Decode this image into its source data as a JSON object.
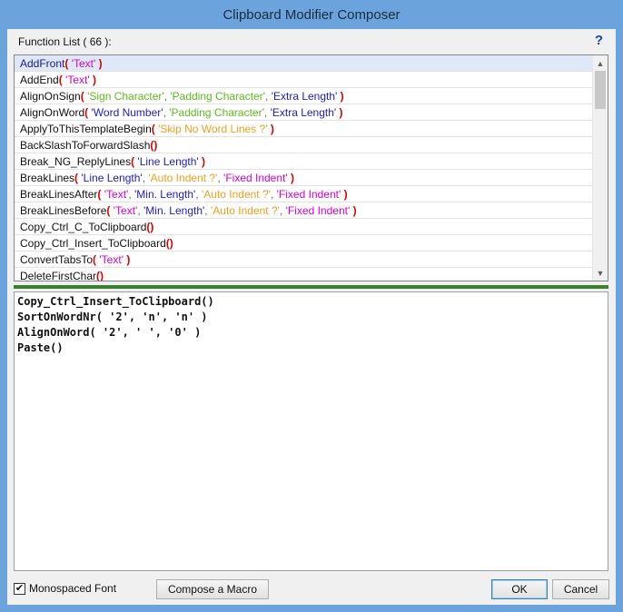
{
  "window": {
    "title": "Clipboard Modifier Composer"
  },
  "function_list": {
    "label": "Function List ( 66 ):",
    "help": "?",
    "selected_index": 0,
    "items": [
      {
        "name": "AddFront",
        "args": [
          {
            "text": "'Text'",
            "color": "#d400d4"
          }
        ]
      },
      {
        "name": "AddEnd",
        "args": [
          {
            "text": "'Text'",
            "color": "#d400d4"
          }
        ]
      },
      {
        "name": "AlignOnSign",
        "args": [
          {
            "text": "'Sign Character'",
            "color": "#5fba1f"
          },
          {
            "text": "'Padding Character'",
            "color": "#5fba1f"
          },
          {
            "text": "'Extra Length'",
            "color": "#1c1cc8"
          }
        ]
      },
      {
        "name": "AlignOnWord",
        "args": [
          {
            "text": "'Word Number'",
            "color": "#1c1cc8"
          },
          {
            "text": "'Padding Character'",
            "color": "#5fba1f"
          },
          {
            "text": "'Extra Length'",
            "color": "#1c1cc8"
          }
        ]
      },
      {
        "name": "ApplyToThisTemplateBegin",
        "args": [
          {
            "text": "'Skip No Word Lines ?'",
            "color": "#f0a020"
          }
        ]
      },
      {
        "name": "BackSlashToForwardSlash",
        "args": []
      },
      {
        "name": "Break_NG_ReplyLines",
        "args": [
          {
            "text": "'Line Length'",
            "color": "#1c1cc8"
          }
        ]
      },
      {
        "name": "BreakLines",
        "args": [
          {
            "text": "'Line Length'",
            "color": "#1c1cc8"
          },
          {
            "text": "'Auto Indent ?'",
            "color": "#f0a020"
          },
          {
            "text": "'Fixed Indent'",
            "color": "#d400d4"
          }
        ]
      },
      {
        "name": "BreakLinesAfter",
        "args": [
          {
            "text": "'Text'",
            "color": "#d400d4"
          },
          {
            "text": "'Min. Length'",
            "color": "#1c1cc8"
          },
          {
            "text": "'Auto Indent ?'",
            "color": "#f0a020"
          },
          {
            "text": "'Fixed Indent'",
            "color": "#d400d4"
          }
        ]
      },
      {
        "name": "BreakLinesBefore",
        "args": [
          {
            "text": "'Text'",
            "color": "#d400d4"
          },
          {
            "text": "'Min. Length'",
            "color": "#1c1cc8"
          },
          {
            "text": "'Auto Indent ?'",
            "color": "#f0a020"
          },
          {
            "text": "'Fixed Indent'",
            "color": "#d400d4"
          }
        ]
      },
      {
        "name": "Copy_Ctrl_C_ToClipboard",
        "args": []
      },
      {
        "name": "Copy_Ctrl_Insert_ToClipboard",
        "args": []
      },
      {
        "name": "ConvertTabsTo",
        "args": [
          {
            "text": "'Text'",
            "color": "#d400d4"
          }
        ]
      },
      {
        "name": "DeleteFirstChar",
        "args": []
      }
    ]
  },
  "editor": {
    "lines": [
      "Copy_Ctrl_Insert_ToClipboard()",
      "SortOnWordNr( '2', 'n', 'n' )",
      "AlignOnWord( '2', ' ', '0' )",
      "Paste()"
    ]
  },
  "footer": {
    "monospace_label": "Monospaced Font",
    "monospace_checked": true,
    "compose_label": "Compose a Macro",
    "ok_label": "OK",
    "cancel_label": "Cancel"
  },
  "colors": {
    "title_bar": "#6ba4dc",
    "divider": "#3a7f2e",
    "selection": "#dfe8f6",
    "paren": "#e00000"
  }
}
